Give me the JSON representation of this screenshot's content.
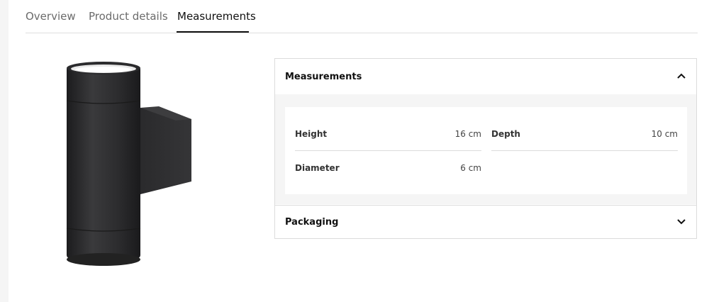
{
  "tabs": [
    {
      "label": "Overview",
      "active": false
    },
    {
      "label": "Product details",
      "active": false
    },
    {
      "label": "Measurements",
      "active": true
    }
  ],
  "measurements_section": {
    "title": "Measurements",
    "expanded": true,
    "toggle_icon": "chevron-up-icon",
    "items": [
      {
        "label": "Height",
        "value": "16 cm"
      },
      {
        "label": "Depth",
        "value": "10 cm"
      },
      {
        "label": "Diameter",
        "value": "6 cm"
      }
    ]
  },
  "packaging_section": {
    "title": "Packaging",
    "expanded": false,
    "toggle_icon": "chevron-down-icon"
  },
  "colors": {
    "product": "#2b2b2d",
    "panel_bg": "#f5f5f5",
    "border": "#dcdcdc"
  }
}
